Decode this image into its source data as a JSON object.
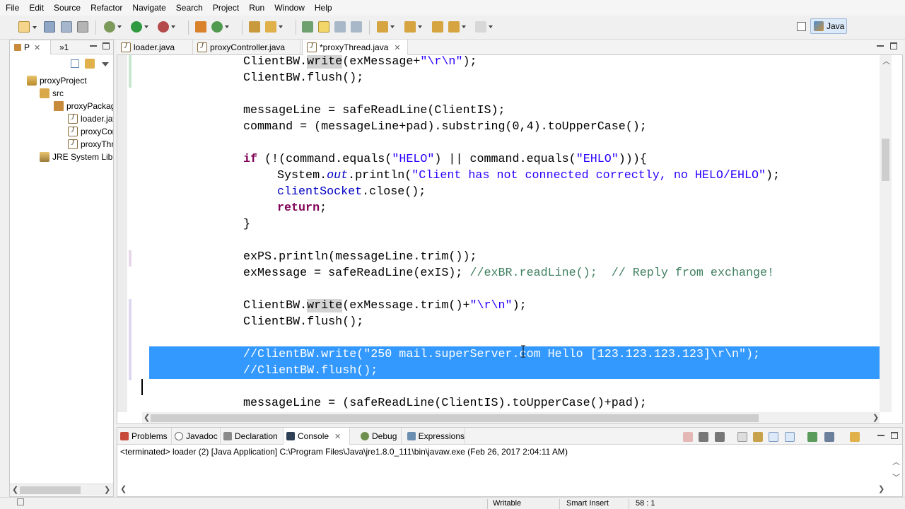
{
  "menu": [
    "File",
    "Edit",
    "Source",
    "Refactor",
    "Navigate",
    "Search",
    "Project",
    "Run",
    "Window",
    "Help"
  ],
  "perspective": {
    "label": "Java"
  },
  "left_panel": {
    "tab_active": "P",
    "tab_other": "»1",
    "tree": {
      "project": "proxyProject",
      "src": "src",
      "package": "proxyPackage",
      "files": [
        "loader.java",
        "proxyController.java",
        "proxyThread.java"
      ],
      "jre": "JRE System Library"
    }
  },
  "editor": {
    "tabs": [
      {
        "label": "loader.java"
      },
      {
        "label": "proxyController.java"
      },
      {
        "label": "*proxyThread.java"
      }
    ],
    "lines": {
      "l1_a": "ClientBW.",
      "l1_b": "write",
      "l1_c": "(exMessage+",
      "l1_d": "\"\\r\\n\"",
      "l1_e": ");",
      "l2": "ClientBW.flush();",
      "l4": "messageLine = safeReadLine(ClientIS);",
      "l5": "command = (messageLine+pad).substring(0,4).toUpperCase();",
      "l7_kw": "if",
      "l7_a": " (!(command.equals(",
      "l7_s1": "\"HELO\"",
      "l7_b": ") || command.equals(",
      "l7_s2": "\"EHLO\"",
      "l7_c": "))){",
      "l8_a": "System.",
      "l8_out": "out",
      "l8_b": ".println(",
      "l8_s": "\"Client has not connected correctly, no HELO/EHLO\"",
      "l8_c": ");",
      "l9_fld": "clientSocket",
      "l9_b": ".close();",
      "l10_kw": "return",
      "l10_b": ";",
      "l11": "}",
      "l13": "exPS.println(messageLine.trim());",
      "l14_a": "exMessage = safeReadLine(exIS); ",
      "l14_c": "//exBR.readLine();  // Reply from exchange!",
      "l16_a": "ClientBW.",
      "l16_b": "write",
      "l16_c": "(exMessage.trim()+",
      "l16_d": "\"\\r\\n\"",
      "l16_e": ");",
      "l17": "ClientBW.flush();",
      "l19": "//ClientBW.write(\"250 mail.superServer.com Hello [123.123.123.123]\\r\\n\");",
      "l20": "//ClientBW.flush();",
      "l22": "messageLine = (safeReadLine(ClientIS).toUpperCase()+pad);"
    }
  },
  "bottom_panel": {
    "tabs": [
      {
        "label": "Problems"
      },
      {
        "label": "Javadoc"
      },
      {
        "label": "Declaration"
      },
      {
        "label": "Console"
      },
      {
        "label": "Debug"
      },
      {
        "label": "Expressions"
      }
    ],
    "console_description": "<terminated> loader (2) [Java Application] C:\\Program Files\\Java\\jre1.8.0_111\\bin\\javaw.exe (Feb 26, 2017 2:04:11 AM)"
  },
  "status_bar": {
    "writable": "Writable",
    "insert_mode": "Smart Insert",
    "position": "58 : 1"
  },
  "colors": {
    "selection": "#3399ff",
    "keyword": "#7f0055",
    "string": "#2a00ff",
    "comment": "#3f7f5f",
    "field": "#0000c0"
  }
}
